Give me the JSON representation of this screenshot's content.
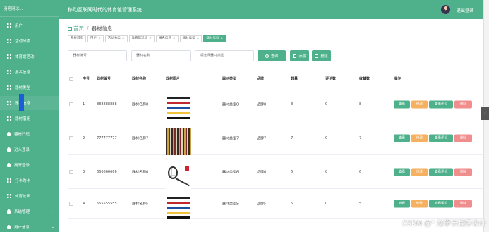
{
  "app": {
    "brand": "羽毛网球...",
    "title": "移动互联网时代的体育馆管理系统",
    "logout": "退出登录"
  },
  "sidebar": {
    "items": [
      {
        "label": "用户",
        "icon": "grid-icon"
      },
      {
        "label": "活动分类",
        "icon": "grid-icon"
      },
      {
        "label": "体育馆活动",
        "icon": "grid-icon"
      },
      {
        "label": "报名信息",
        "icon": "grid-icon"
      },
      {
        "label": "器材类型",
        "icon": "grid-icon"
      },
      {
        "label": "器材信息",
        "icon": "grid-icon"
      },
      {
        "label": "器材借用",
        "icon": "grid-icon"
      },
      {
        "label": "器材归还",
        "icon": "user-icon"
      },
      {
        "label": "进入登录",
        "icon": "user-icon"
      },
      {
        "label": "离开登录",
        "icon": "user-icon"
      },
      {
        "label": "打卡购卡",
        "icon": "grid-icon"
      },
      {
        "label": "体育论坛",
        "icon": "grid-icon"
      },
      {
        "label": "系统管理",
        "icon": "user-icon"
      },
      {
        "label": "用户信息",
        "icon": "user-icon"
      }
    ]
  },
  "breadcrumb": {
    "home": "首页",
    "sep": "/",
    "current": "器材信息"
  },
  "tags": [
    {
      "label": "系统首页",
      "closable": false,
      "active": false
    },
    {
      "label": "用户",
      "closable": true,
      "active": false
    },
    {
      "label": "活动分类",
      "closable": true,
      "active": false
    },
    {
      "label": "体育馆活动",
      "closable": true,
      "active": false
    },
    {
      "label": "报名信息",
      "closable": true,
      "active": false
    },
    {
      "label": "器材类型",
      "closable": true,
      "active": false
    },
    {
      "label": "器材信息",
      "closable": true,
      "active": true
    }
  ],
  "filters": {
    "code_placeholder": "器材编号",
    "name_placeholder": "器材名称",
    "type_placeholder": "请选择器材类型",
    "search_label": "查询",
    "add_label": "添加",
    "delete_label": "删除"
  },
  "table": {
    "columns": [
      "序号",
      "器材编号",
      "器材名称",
      "器材图片",
      "器材类型",
      "品牌",
      "数量",
      "评论数",
      "收藏数",
      "操作"
    ],
    "rows": [
      {
        "index": "1",
        "code": "888888888",
        "name": "器材名称8",
        "image": "ropes",
        "type": "器材类型8",
        "brand": "品牌8",
        "qty": "8",
        "comments": "0",
        "favs": "8"
      },
      {
        "index": "2",
        "code": "777777777",
        "name": "器材名称7",
        "image": "shop",
        "type": "器材类型7",
        "brand": "品牌7",
        "qty": "7",
        "comments": "0",
        "favs": "7"
      },
      {
        "index": "3",
        "code": "666666666",
        "name": "器材名称6",
        "image": "racket",
        "type": "器材类型6",
        "brand": "品牌6",
        "qty": "6",
        "comments": "0",
        "favs": "6"
      },
      {
        "index": "4",
        "code": "555555555",
        "name": "器材名称5",
        "image": "ropes",
        "type": "器材类型5",
        "brand": "品牌5",
        "qty": "5",
        "comments": "0",
        "favs": "5"
      }
    ],
    "actions": {
      "view": "查看",
      "edit": "修改",
      "review": "查看评论",
      "delete": "删除"
    }
  },
  "watermark": "CSDN @\" 赵学长程序设计",
  "colors": {
    "primary": "#4fb08c",
    "edit": "#f5b15f",
    "delete": "#f08d8d"
  }
}
